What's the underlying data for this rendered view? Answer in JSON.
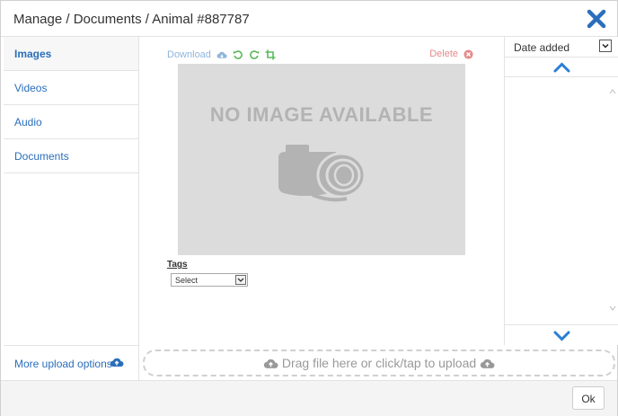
{
  "header": {
    "title": "Manage / Documents / Animal #887787"
  },
  "sidebar": {
    "items": [
      {
        "label": "Images"
      },
      {
        "label": "Videos"
      },
      {
        "label": "Audio"
      },
      {
        "label": "Documents"
      }
    ],
    "more_upload": "More upload options"
  },
  "toolbar": {
    "download": "Download",
    "delete": "Delete"
  },
  "image": {
    "placeholder_text": "NO IMAGE AVAILABLE"
  },
  "tags": {
    "label": "Tags",
    "selected": "Select"
  },
  "right_panel": {
    "sort_selected": "Date added"
  },
  "upload": {
    "text": "Drag file here or click/tap to upload"
  },
  "footer": {
    "ok": "Ok"
  },
  "colors": {
    "link": "#2a6ebb",
    "close": "#2a6ebb",
    "delete": "#e58a8a",
    "tool_green": "#5cb85c",
    "chevron": "#2a7fd4"
  }
}
